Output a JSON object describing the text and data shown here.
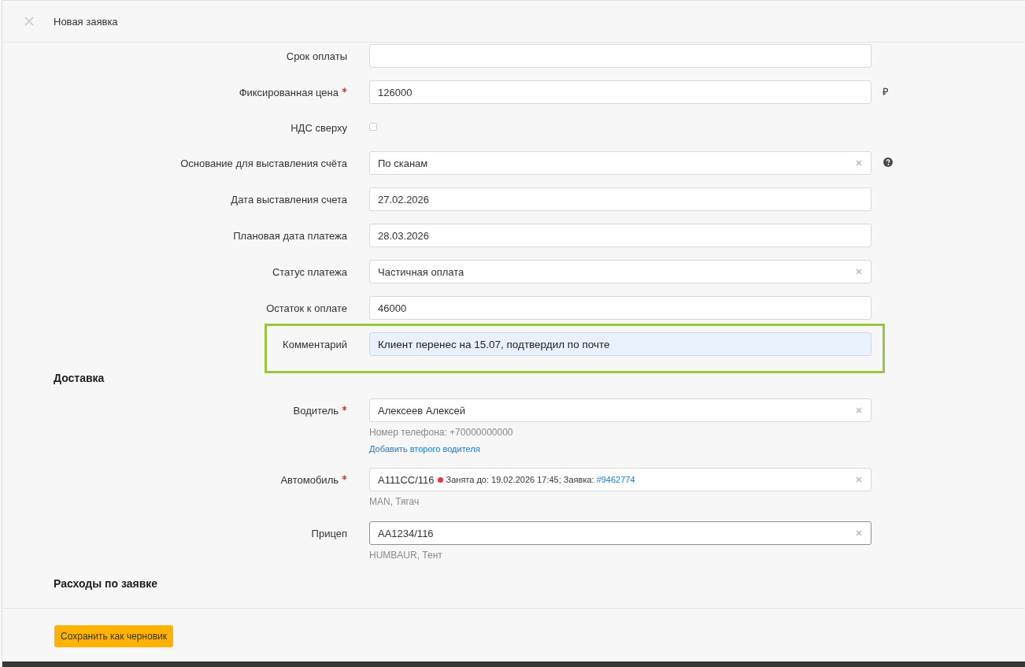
{
  "header": {
    "title": "Новая заявка"
  },
  "payment_fields": [
    {
      "kind": "text",
      "label": "Срок оплаты",
      "required": false,
      "highlighted": false
    },
    {
      "kind": "text",
      "label": "Фиксированная цена",
      "required": true,
      "highlighted": false,
      "value": "126000",
      "suffix": "₽"
    },
    {
      "kind": "checkbox",
      "label": "НДС сверху",
      "required": false,
      "highlighted": false,
      "checked": false
    },
    {
      "kind": "select",
      "label": "Основание для выставления счёта",
      "required": false,
      "highlighted": false,
      "value": "По сканам",
      "help": true
    },
    {
      "kind": "text",
      "label": "Дата выставления счета",
      "required": false,
      "highlighted": false,
      "value": "27.02.2026"
    },
    {
      "kind": "text",
      "label": "Плановая дата платежа",
      "required": false,
      "highlighted": false,
      "value": "28.03.2026"
    },
    {
      "kind": "select",
      "label": "Статус платежа",
      "required": false,
      "highlighted": false,
      "value": "Частичная оплата"
    },
    {
      "kind": "text",
      "label": "Остаток к оплате",
      "required": false,
      "highlighted": false,
      "value": "46000"
    },
    {
      "kind": "text",
      "label": "Комментарий",
      "required": false,
      "highlighted": true,
      "value": "Клиент перенес на 15.07, подтвердил по почте"
    }
  ],
  "delivery": {
    "title": "Доставка",
    "fields": [
      {
        "kind": "select",
        "label": "Водитель",
        "required": true,
        "focused": false,
        "value": "Алексеев Алексей",
        "hint": "Номер телефона: +70000000000",
        "link": "Добавить второго водителя"
      },
      {
        "kind": "select",
        "label": "Автомобиль",
        "required": true,
        "focused": false,
        "value": "А111СС/116",
        "status": {
          "color": "#e53935",
          "text": "Занята до: 19.02.2026 17:45; Заявка:",
          "link": "#9462774"
        },
        "hint": "MAN, Тягач"
      },
      {
        "kind": "select",
        "label": "Прицеп",
        "required": false,
        "focused": true,
        "value": "АА1234/116",
        "hint": "HUMBAUR, Тент"
      }
    ]
  },
  "expenses": {
    "title": "Расходы по заявке"
  },
  "footer": {
    "buttons": [
      {
        "kind": "primary",
        "label": "Сохранить как черновик"
      }
    ]
  }
}
